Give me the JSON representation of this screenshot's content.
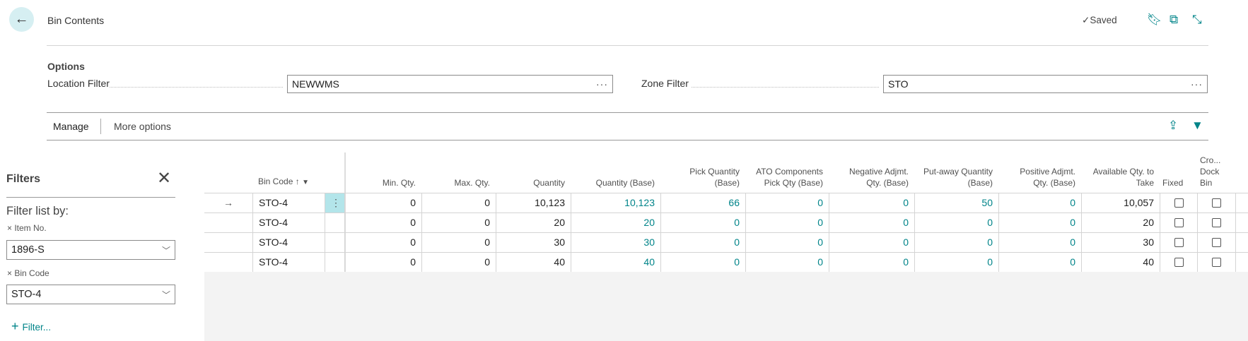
{
  "header": {
    "title": "Bin Contents",
    "saved": "Saved"
  },
  "options": {
    "heading": "Options",
    "location_label": "Location Filter",
    "location_value": "NEWWMS",
    "zone_label": "Zone Filter",
    "zone_value": "STO",
    "ellipsis": "···"
  },
  "actions": {
    "manage": "Manage",
    "more": "More options"
  },
  "filters": {
    "title": "Filters",
    "list_by": "Filter list by:",
    "f1_label": "Item No.",
    "f1_value": "1896-S",
    "f2_label": "Bin Code",
    "f2_value": "STO-4",
    "add": "Filter..."
  },
  "columns": {
    "bin_code": "Bin Code",
    "min": "Min. Qty.",
    "max": "Max. Qty.",
    "qty": "Quantity",
    "qty_base": "Quantity (Base)",
    "pick": "Pick Quantity (Base)",
    "ato": "ATO Components Pick Qty (Base)",
    "neg": "Negative Adjmt. Qty. (Base)",
    "put": "Put-away Quantity (Base)",
    "pos": "Positive Adjmt. Qty. (Base)",
    "avail": "Available Qty. to Take",
    "fixed": "Fixed",
    "cross": "Cro... Dock Bin"
  },
  "rows": [
    {
      "bin": "STO-4",
      "min": "0",
      "max": "0",
      "qty": "10,123",
      "qty_base": "10,123",
      "pick": "66",
      "ato": "0",
      "neg": "0",
      "put": "50",
      "pos": "0",
      "avail": "10,057"
    },
    {
      "bin": "STO-4",
      "min": "0",
      "max": "0",
      "qty": "20",
      "qty_base": "20",
      "pick": "0",
      "ato": "0",
      "neg": "0",
      "put": "0",
      "pos": "0",
      "avail": "20"
    },
    {
      "bin": "STO-4",
      "min": "0",
      "max": "0",
      "qty": "30",
      "qty_base": "30",
      "pick": "0",
      "ato": "0",
      "neg": "0",
      "put": "0",
      "pos": "0",
      "avail": "30"
    },
    {
      "bin": "STO-4",
      "min": "0",
      "max": "0",
      "qty": "40",
      "qty_base": "40",
      "pick": "0",
      "ato": "0",
      "neg": "0",
      "put": "0",
      "pos": "0",
      "avail": "40"
    }
  ]
}
